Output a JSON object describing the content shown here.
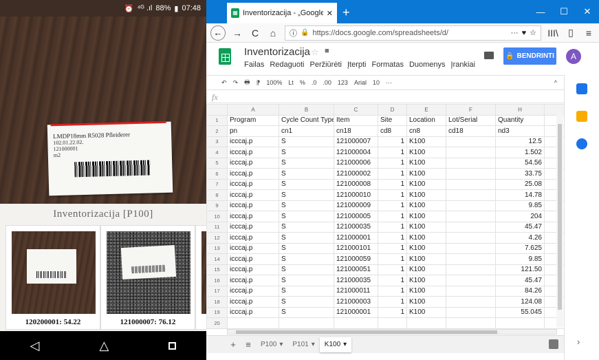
{
  "phone": {
    "status": {
      "alarm": "⏰",
      "signal": "⁴ᴳ .ıl",
      "battery": "88%",
      "time": "07:48"
    },
    "label": {
      "line1": "LMDP18mm R5028 Pfleiderer",
      "line2": "102.01.22.02.",
      "line3": "121000001",
      "line4": "m2"
    },
    "title": "Inventorizacija [P100]",
    "thumbs": [
      {
        "caption": "120200001: 54.22"
      },
      {
        "caption": "121000007: 76.12"
      }
    ],
    "nav": {
      "back": "◁",
      "home": "△"
    }
  },
  "browser": {
    "tab_title": "Inventorizacija - „Google“ skaič",
    "new_tab": "+",
    "window_controls": [
      "—",
      "☐",
      "✕"
    ],
    "url": "https://docs.google.com/spreadsheets/d/",
    "toolbar_icons": {
      "back": "←",
      "forward": "→",
      "reload": "C",
      "home": "⌂",
      "more": "···",
      "pocket": "♥",
      "star": "☆",
      "library": "III\\",
      "sidebar": "▯",
      "menu": "≡"
    }
  },
  "sheets": {
    "doc_title": "Inventorizacija",
    "star": "☆",
    "folder": "■",
    "menu": [
      "Failas",
      "Redaguoti",
      "Peržiūrėti",
      "Įterpti",
      "Formatas",
      "Duomenys",
      "Įrankiai"
    ],
    "share_label": "BENDRINTI",
    "avatar_letter": "A",
    "format_toolbar": [
      "↶",
      "↷",
      "🖶",
      "⁋",
      "100%",
      "Lt",
      "%",
      ".0",
      ".00",
      "123",
      "Arial",
      "10",
      "···",
      "^"
    ],
    "fx": "fx",
    "columns": [
      "A",
      "B",
      "C",
      "D",
      "E",
      "F",
      "G",
      "H"
    ],
    "rows": [
      [
        "1",
        "Program",
        "Cycle Count Type",
        "Item",
        "Site",
        "Location",
        "Lot/Serial",
        "Quantity"
      ],
      [
        "2",
        "pn",
        "cn1",
        "cn18",
        "cd8",
        "cn8",
        "cd18",
        "nd3"
      ],
      [
        "3",
        "icccaj.p",
        "S",
        "121000007",
        "1",
        "K100",
        "",
        "12.5"
      ],
      [
        "4",
        "icccaj.p",
        "S",
        "121000004",
        "1",
        "K100",
        "",
        "1.502"
      ],
      [
        "5",
        "icccaj.p",
        "S",
        "121000006",
        "1",
        "K100",
        "",
        "54.56"
      ],
      [
        "6",
        "icccaj.p",
        "S",
        "121000002",
        "1",
        "K100",
        "",
        "33.75"
      ],
      [
        "7",
        "icccaj.p",
        "S",
        "121000008",
        "1",
        "K100",
        "",
        "25.08"
      ],
      [
        "8",
        "icccaj.p",
        "S",
        "121000010",
        "1",
        "K100",
        "",
        "14.78"
      ],
      [
        "9",
        "icccaj.p",
        "S",
        "121000009",
        "1",
        "K100",
        "",
        "9.85"
      ],
      [
        "10",
        "icccaj.p",
        "S",
        "121000005",
        "1",
        "K100",
        "",
        "204"
      ],
      [
        "11",
        "icccaj.p",
        "S",
        "121000035",
        "1",
        "K100",
        "",
        "45.47"
      ],
      [
        "12",
        "icccaj.p",
        "S",
        "121000001",
        "1",
        "K100",
        "",
        "4.26"
      ],
      [
        "13",
        "icccaj.p",
        "S",
        "121000101",
        "1",
        "K100",
        "",
        "7.625"
      ],
      [
        "14",
        "icccaj.p",
        "S",
        "121000059",
        "1",
        "K100",
        "",
        "9.85"
      ],
      [
        "15",
        "icccaj.p",
        "S",
        "121000051",
        "1",
        "K100",
        "",
        "121.50"
      ],
      [
        "16",
        "icccaj.p",
        "S",
        "121000035",
        "1",
        "K100",
        "",
        "45.47"
      ],
      [
        "17",
        "icccaj.p",
        "S",
        "121000011",
        "1",
        "K100",
        "",
        "84.26"
      ],
      [
        "18",
        "icccaj.p",
        "S",
        "121000003",
        "1",
        "K100",
        "",
        "124.08"
      ],
      [
        "19",
        "icccaj.p",
        "S",
        "121000001",
        "1",
        "K100",
        "",
        "55.045"
      ],
      [
        "20",
        "",
        "",
        "",
        "",
        "",
        "",
        ""
      ]
    ],
    "sheet_tabs": [
      "P100",
      "P101",
      "K100"
    ],
    "active_sheet": "K100",
    "sheetbar_add": "+",
    "sheetbar_list": "≡",
    "side_arrow": "›"
  }
}
